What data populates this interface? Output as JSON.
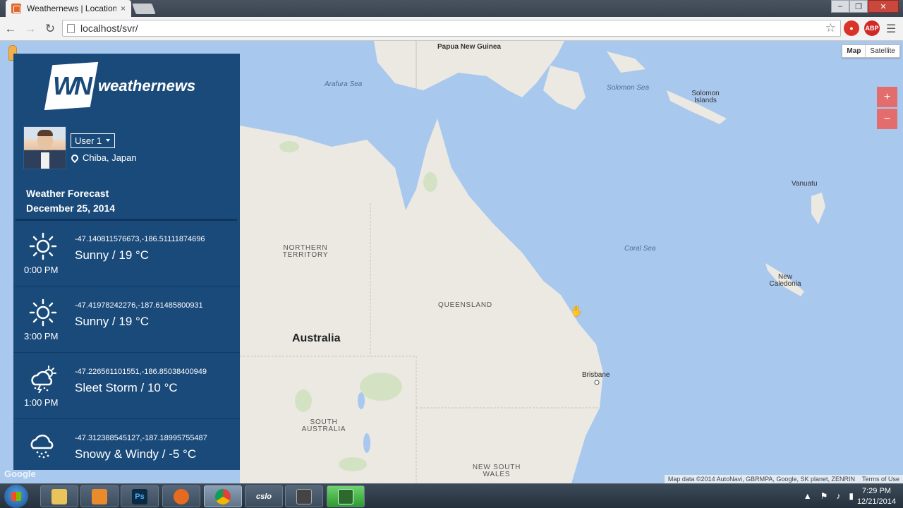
{
  "browser": {
    "tab_title": "Weathernews | Location P",
    "tab_close": "×",
    "url": "localhost/svr/",
    "win_min": "–",
    "win_max": "❐",
    "win_close": "✕",
    "ext_abp": "ABP"
  },
  "map": {
    "type_options": [
      "Map",
      "Satellite"
    ],
    "zoom_in": "+",
    "zoom_out": "−",
    "google": "Google",
    "attribution": "Map data ©2014 AutoNavi, GBRMPA, Google, SK planet, ZENRIN",
    "terms": "Terms of Use",
    "labels": {
      "papua": "Papua New Guinea",
      "arafura": "Arafura Sea",
      "solomon_sea": "Solomon Sea",
      "solomon_islands": "Solomon Islands",
      "vanuatu": "Vanuatu",
      "coral_sea": "Coral Sea",
      "new_caledonia": "New Caledonia",
      "northern_territory": "NORTHERN TERRITORY",
      "queensland": "QUEENSLAND",
      "australia": "Australia",
      "brisbane": "Brisbane",
      "south_australia": "SOUTH AUSTRALIA",
      "nsw": "NEW SOUTH WALES"
    }
  },
  "panel": {
    "logo_mark": "WN",
    "logo_text": "weathernews",
    "user": "User 1",
    "location": "Chiba, Japan",
    "forecast_title": "Weather Forecast",
    "forecast_date": "December 25, 2014",
    "items": [
      {
        "icon": "sun-icon",
        "coords": "-47.140811576673,-186.51111874696",
        "condition": "Sunny / 19 °C",
        "time": "0:00 PM"
      },
      {
        "icon": "sun-icon",
        "coords": "-47.41978242276,-187.61485800931",
        "condition": "Sunny / 19 °C",
        "time": "3:00 PM"
      },
      {
        "icon": "sleet-storm-icon",
        "coords": "-47.226561101551,-186.85038400949",
        "condition": "Sleet Storm / 10 °C",
        "time": "1:00 PM"
      },
      {
        "icon": "snow-wind-icon",
        "coords": "-47.312388545127,-187.18995755487",
        "condition": "Snowy & Windy / -5 °C",
        "time": ""
      }
    ]
  },
  "taskbar": {
    "clock_time": "7:29 PM",
    "clock_date": "12/21/2014",
    "apps": [
      "explorer",
      "media-player",
      "Ps",
      "firefox",
      "chrome",
      "cslo",
      "app7",
      "app8"
    ]
  },
  "colors": {
    "panel": "#1a4a7a",
    "ocean": "#a9c8ee",
    "land": "#ebe9e2",
    "zoom": "#e36c6c"
  }
}
